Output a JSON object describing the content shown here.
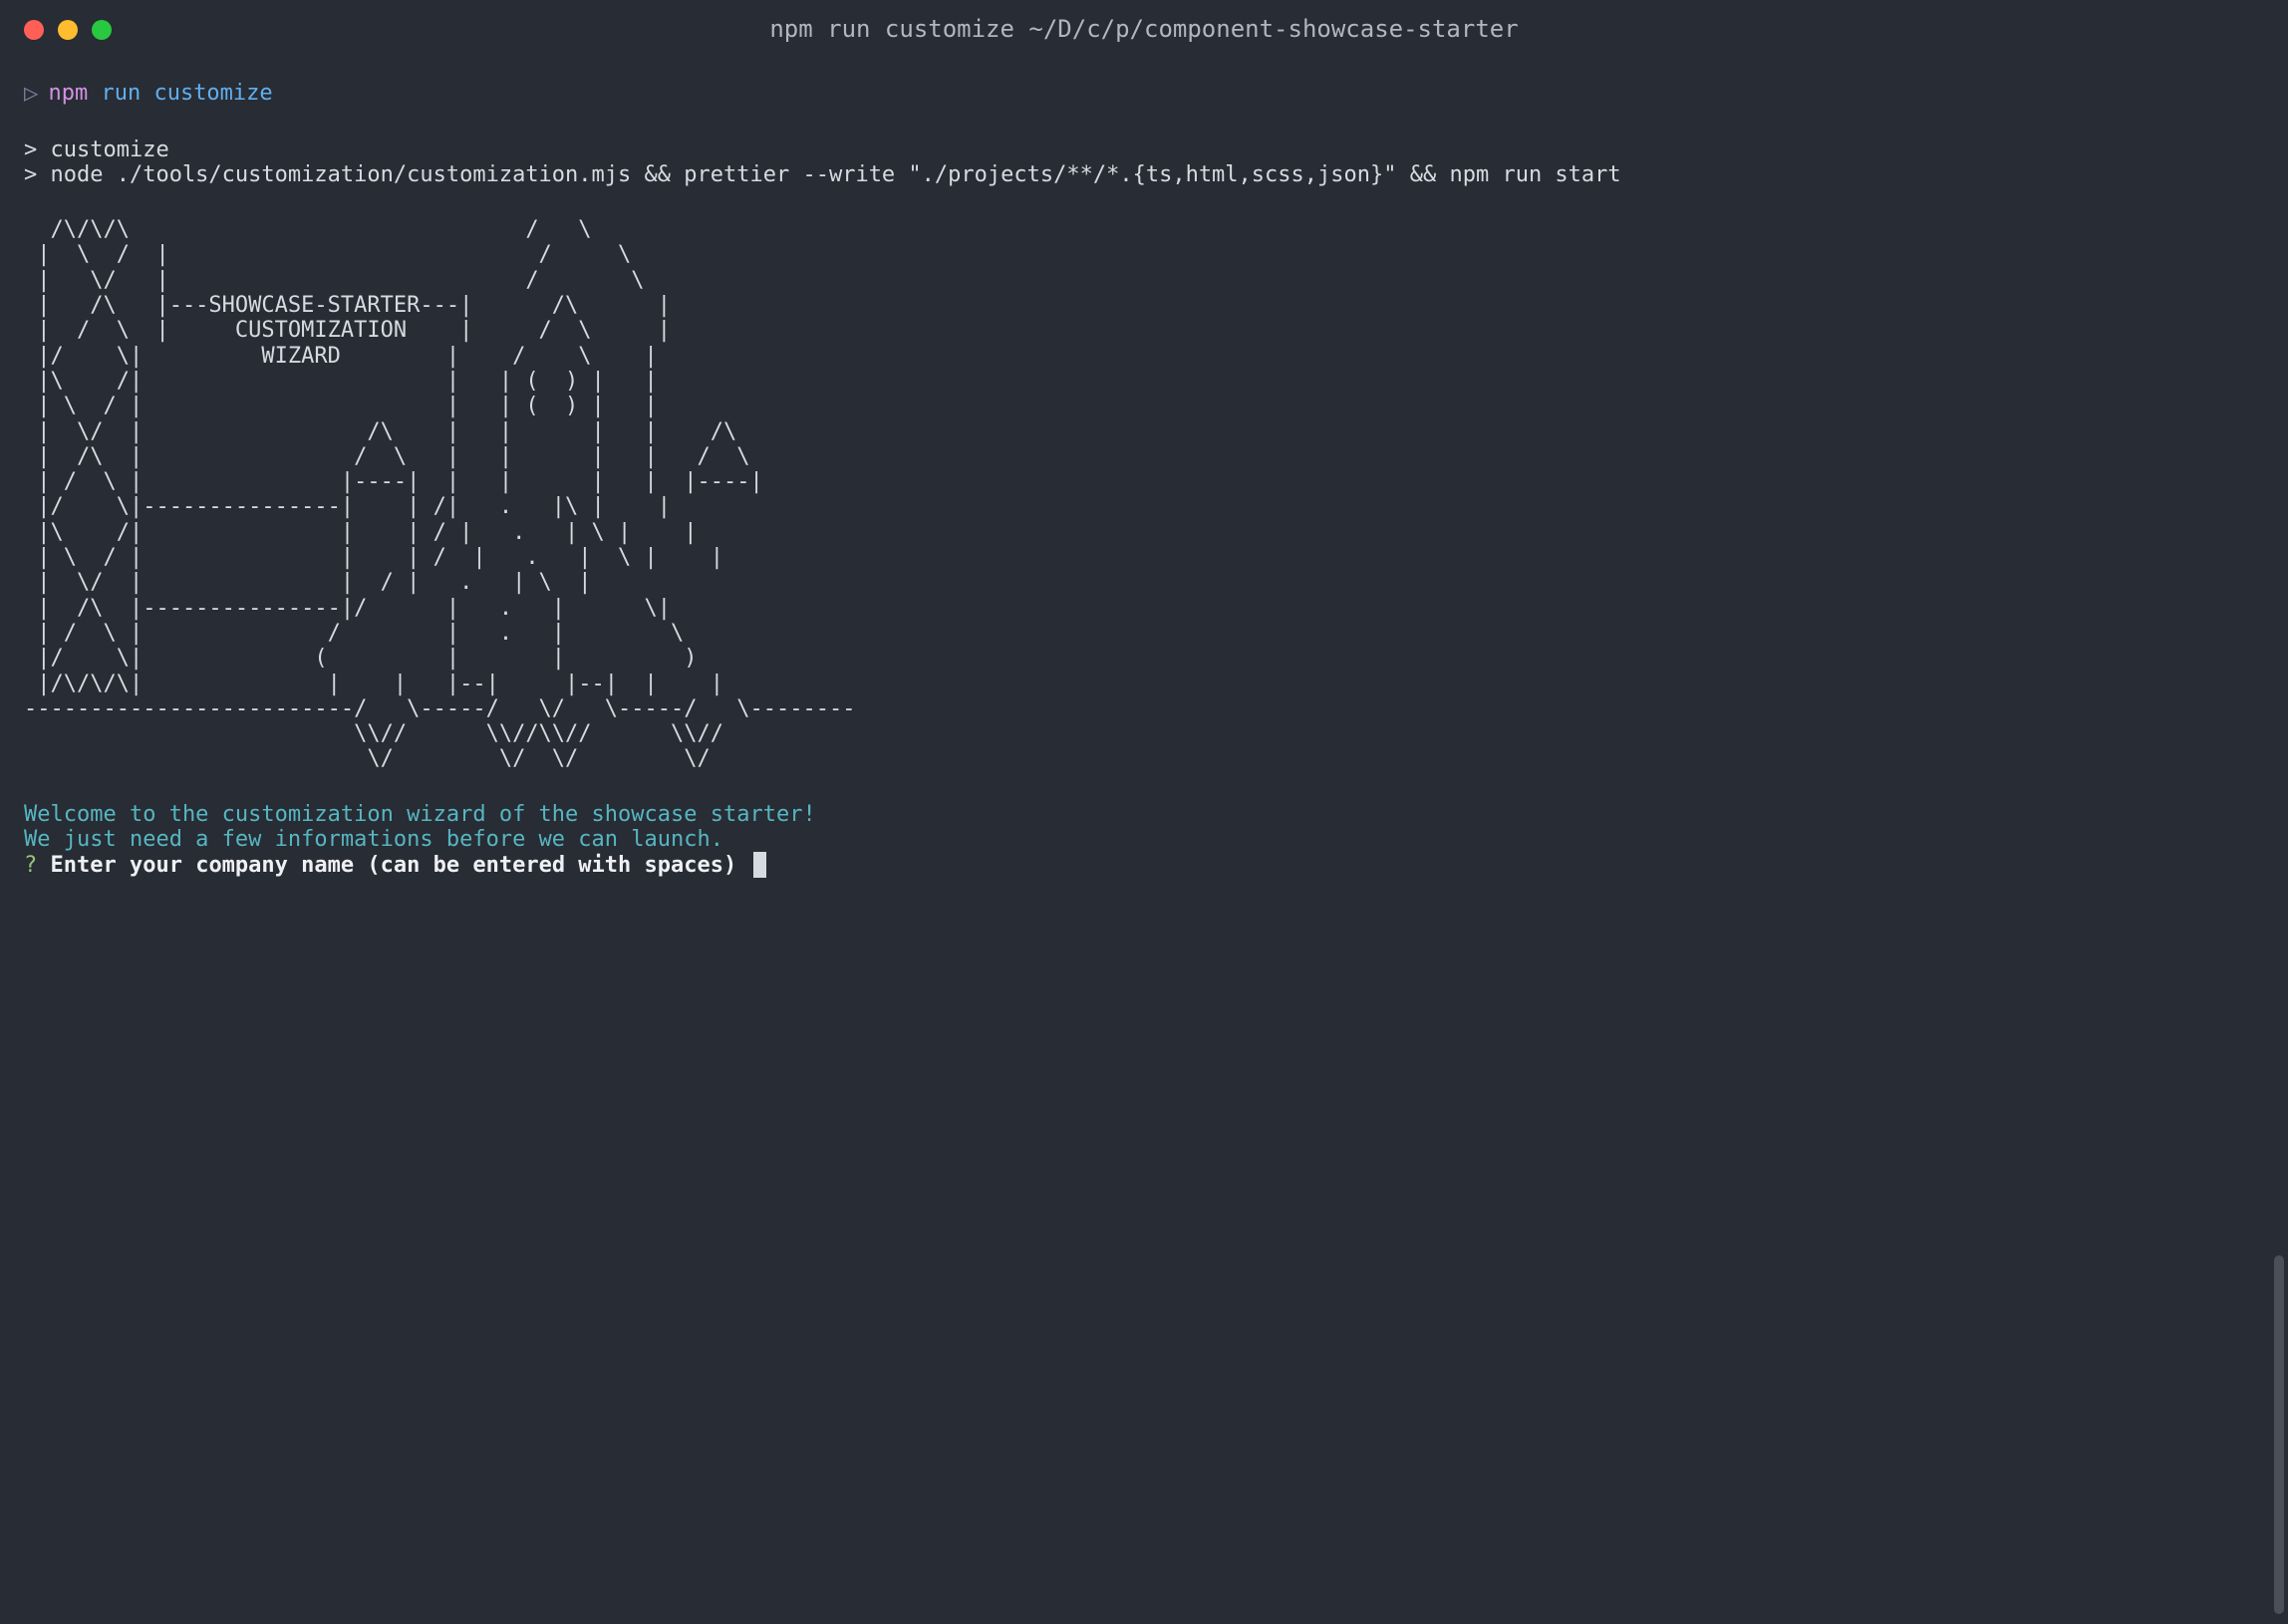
{
  "window": {
    "title": "npm run customize ~/D/c/p/component-showcase-starter"
  },
  "command": {
    "npm": "npm",
    "run": "run",
    "customize": "customize"
  },
  "output": {
    "line1": "> customize",
    "line2": "> node ./tools/customization/customization.mjs && prettier --write \"./projects/**/*.{ts,html,scss,json}\" && npm run start"
  },
  "ascii": "  /\\/\\/\\                              /   \\\n |  \\  /  |                            /     \\\n |   \\/   |                           /       \\\n |   /\\   |---SHOWCASE-STARTER---|      /\\      |\n |  /  \\  |     CUSTOMIZATION    |     /  \\     |\n |/    \\|         WIZARD        |    /    \\    |\n |\\    /|                       |   | (  ) |   |\n | \\  / |                       |   | (  ) |   |\n |  \\/  |                 /\\    |   |      |   |    /\\\n |  /\\  |                /  \\   |   |      |   |   /  \\\n | /  \\ |               |----|  |   |      |   |  |----|\n |/    \\|---------------|    | /|   .   |\\ |    |\n |\\    /|               |    | / |   .   | \\ |    |\n | \\  / |               |    | /  |   .   |  \\ |    |\n |  \\/  |               |  / |   .   | \\  |\n |  /\\  |---------------|/      |   .   |      \\|\n | /  \\ |              /        |   .   |        \\\n |/    \\|             (         |       |         )\n |/\\/\\/\\|              |    |   |--|     |--|  |    |\n-------------------------/   \\-----/   \\/   \\-----/   \\--------\n                         \\\\//      \\\\//\\\\//      \\\\//\n                          \\/        \\/  \\/        \\/",
  "welcome": {
    "line1": "Welcome to the customization wizard of the showcase starter!",
    "line2": "We just need a few informations before we can launch."
  },
  "prompt": {
    "qmark": "?",
    "text": "Enter your company name (can be entered with spaces)"
  }
}
